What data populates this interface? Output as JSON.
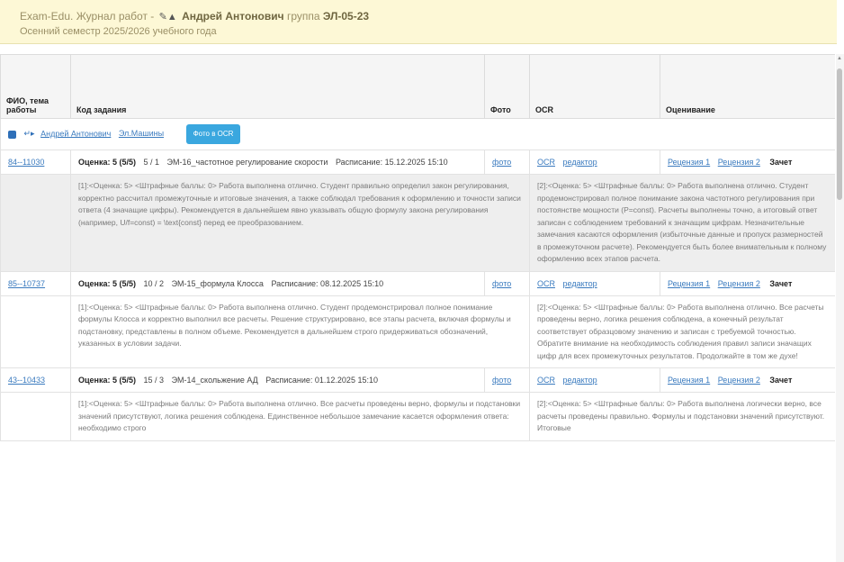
{
  "header": {
    "app": "Exam-Edu.",
    "journal": "Журнал работ -",
    "student": "Андрей Антонович",
    "group_prefix": "группа",
    "group": "ЭЛ-05-23",
    "semester": "Осенний семестр 2025/2026 учебного года"
  },
  "columns": {
    "fio": "ФИО, тема работы",
    "code": "Код задания",
    "photo": "Фото",
    "ocr": "OCR",
    "grading": "Оценивание"
  },
  "student_row": {
    "name_link": "Андрей Антонович",
    "subject_link": "Эл.Машины",
    "button": "Фото в OCR"
  },
  "tasks": [
    {
      "id": "84--11030",
      "grade_label": "Оценка: 5 (5/5)",
      "num": "5 / 1",
      "title": "ЭМ-16_частотное регулирование скорости",
      "schedule": "Расписание: 15.12.2025 15:10",
      "photo": "фото",
      "ocr": "OCR",
      "editor": "редактор",
      "review1": "Рецензия 1",
      "review2": "Рецензия 2",
      "result": "Зачет",
      "comment1": "[1]:<Оценка: 5> <Штрафные баллы: 0> Работа выполнена отлично. Студент правильно определил закон регулирования, корректно рассчитал промежуточные и итоговые значения, а также соблюдал требования к оформлению и точности записи ответа (4 значащие цифры). Рекомендуется в дальнейшем явно указывать общую формулу закона регулирования (например, U/f=const) = \\text{const} перед ее преобразованием.",
      "comment2": "[2]:<Оценка: 5> <Штрафные баллы: 0> Работа выполнена отлично. Студент продемонстрировал полное понимание закона частотного регулирования при постоянстве мощности (P=const). Расчеты выполнены точно, а итоговый ответ записан с соблюдением требований к значащим цифрам. Незначительные замечания касаются оформления (избыточные данные и пропуск размерностей в промежуточном расчете). Рекомендуется быть более внимательным к полному оформлению всех этапов расчета."
    },
    {
      "id": "85--10737",
      "grade_label": "Оценка: 5 (5/5)",
      "num": "10 / 2",
      "title": "ЭМ-15_формула Клосса",
      "schedule": "Расписание: 08.12.2025 15:10",
      "photo": "фото",
      "ocr": "OCR",
      "editor": "редактор",
      "review1": "Рецензия 1",
      "review2": "Рецензия 2",
      "result": "Зачет",
      "comment1": "[1]:<Оценка: 5> <Штрафные баллы: 0> Работа выполнена отлично. Студент продемонстрировал полное понимание формулы Клосса и корректно выполнил все расчеты. Решение структурировано, все этапы расчета, включая формулы и подстановку, представлены в полном объеме. Рекомендуется в дальнейшем строго придерживаться обозначений, указанных в условии задачи.",
      "comment2": "[2]:<Оценка: 5> <Штрафные баллы: 0> Работа выполнена отлично. Все расчеты проведены верно, логика решения соблюдена, а конечный результат соответствует образцовому значению и записан с требуемой точностью. Обратите внимание на необходимость соблюдения правил записи значащих цифр для всех промежуточных результатов. Продолжайте в том же духе!"
    },
    {
      "id": "43--10433",
      "grade_label": "Оценка: 5 (5/5)",
      "num": "15 / 3",
      "title": "ЭМ-14_скольжение АД",
      "schedule": "Расписание: 01.12.2025 15:10",
      "photo": "фото",
      "ocr": "OCR",
      "editor": "редактор",
      "review1": "Рецензия 1",
      "review2": "Рецензия 2",
      "result": "Зачет",
      "comment1": "[1]:<Оценка: 5> <Штрафные баллы: 0> Работа выполнена отлично. Все расчеты проведены верно, формулы и подстановки значений присутствуют, логика решения соблюдена. Единственное небольшое замечание касается оформления ответа: необходимо строго",
      "comment2": "[2]:<Оценка: 5> <Штрафные баллы: 0> Работа выполнена логически верно, все расчеты проведены правильно. Формулы и подстановки значений присутствуют. Итоговые"
    }
  ],
  "colors": {
    "banner_bg": "#fdf8d6",
    "link": "#3b7bbf",
    "button": "#3aa7df",
    "shaded_row": "#eeeeee"
  }
}
